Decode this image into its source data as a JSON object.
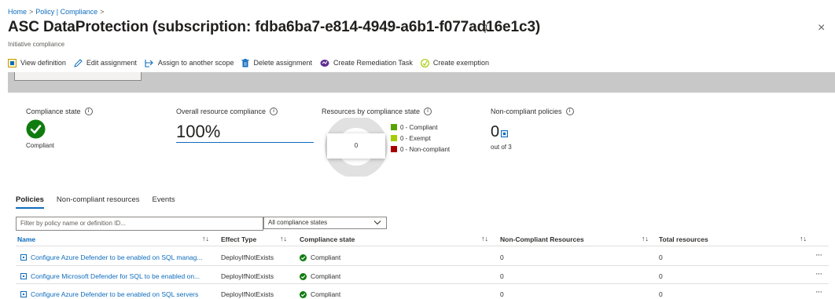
{
  "breadcrumb": [
    "Home",
    "Policy | Compliance"
  ],
  "header": {
    "title": "ASC DataProtection (subscription: fdba6ba7-e814-4949-a6b1-f077ad16e1c3)",
    "subtitle": "Initiative compliance",
    "more": "···",
    "close": "×"
  },
  "toolbar": [
    {
      "label": "View definition",
      "icon": "view-definition-icon"
    },
    {
      "label": "Edit assignment",
      "icon": "edit-icon"
    },
    {
      "label": "Assign to another scope",
      "icon": "assign-icon"
    },
    {
      "label": "Delete assignment",
      "icon": "trash-icon"
    },
    {
      "label": "Create Remediation Task",
      "icon": "remediation-icon"
    },
    {
      "label": "Create exemption",
      "icon": "exemption-icon"
    }
  ],
  "metrics": {
    "compliance_state": {
      "label": "Compliance state",
      "value": "Compliant"
    },
    "overall": {
      "label": "Overall resource compliance",
      "value": "100%"
    },
    "by_state": {
      "label": "Resources by compliance state",
      "total": "0",
      "legend": [
        {
          "label": "0 - Compliant",
          "color": "#57a300"
        },
        {
          "label": "0 - Exempt",
          "color": "#a4cc00"
        },
        {
          "label": "0 - Non-compliant",
          "color": "#a80000"
        }
      ]
    },
    "noncompliant_policies": {
      "label": "Non-compliant policies",
      "count": "0",
      "sub": "out of 3"
    }
  },
  "tabs": [
    {
      "label": "Policies",
      "active": true
    },
    {
      "label": "Non-compliant resources",
      "active": false
    },
    {
      "label": "Events",
      "active": false
    }
  ],
  "filters": {
    "search_placeholder": "Filter by policy name or definition ID...",
    "state_value": "All compliance states"
  },
  "table": {
    "columns": [
      "Name",
      "Effect Type",
      "Compliance state",
      "Non-Compliant Resources",
      "Total resources"
    ],
    "rows": [
      {
        "name": "Configure Azure Defender to be enabled on SQL manag...",
        "effect": "DeployIfNotExists",
        "state": "Compliant",
        "noncompliant": "0",
        "total": "0"
      },
      {
        "name": "Configure Microsoft Defender for SQL to be enabled on...",
        "effect": "DeployIfNotExists",
        "state": "Compliant",
        "noncompliant": "0",
        "total": "0"
      },
      {
        "name": "Configure Azure Defender to be enabled on SQL servers",
        "effect": "DeployIfNotExists",
        "state": "Compliant",
        "noncompliant": "0",
        "total": "0"
      }
    ],
    "row_more": "···",
    "sort_glyph": "↑↓"
  },
  "colors": {
    "accent": "#0f6cbd",
    "compliant": "#107c10"
  }
}
